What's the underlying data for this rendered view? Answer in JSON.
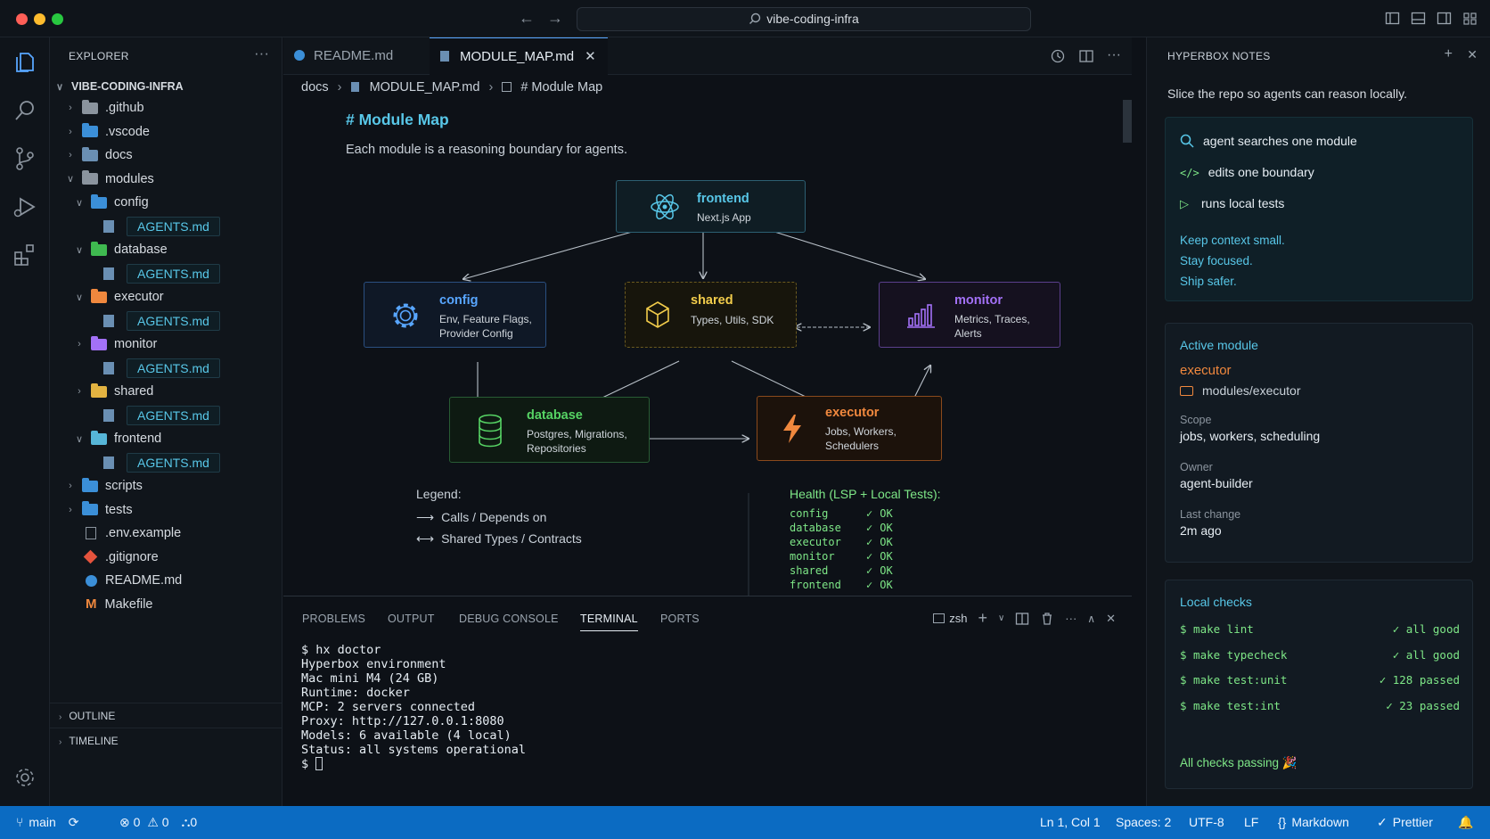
{
  "window": {
    "search": "vibe-coding-infra"
  },
  "explorer": {
    "title": "EXPLORER",
    "root": "VIBE-CODING-INFRA",
    "items": [
      {
        "label": ".github"
      },
      {
        "label": ".vscode"
      },
      {
        "label": "docs"
      },
      {
        "label": "modules"
      },
      {
        "label": "config"
      },
      {
        "label": "AGENTS.md"
      },
      {
        "label": "database"
      },
      {
        "label": "AGENTS.md"
      },
      {
        "label": "executor"
      },
      {
        "label": "AGENTS.md"
      },
      {
        "label": "monitor"
      },
      {
        "label": "AGENTS.md"
      },
      {
        "label": "shared"
      },
      {
        "label": "AGENTS.md"
      },
      {
        "label": "frontend"
      },
      {
        "label": "AGENTS.md"
      },
      {
        "label": "scripts"
      },
      {
        "label": "tests"
      },
      {
        "label": ".env.example"
      },
      {
        "label": ".gitignore"
      },
      {
        "label": "README.md"
      },
      {
        "label": "Makefile"
      }
    ],
    "outline": "OUTLINE",
    "timeline": "TIMELINE"
  },
  "tabs": [
    {
      "label": "README.md"
    },
    {
      "label": "MODULE_MAP.md"
    }
  ],
  "breadcrumb": {
    "a": "docs",
    "b": "MODULE_MAP.md",
    "c": "# Module Map"
  },
  "doc": {
    "heading": "# Module Map",
    "subtitle": "Each module is a reasoning boundary for agents.",
    "nodes": {
      "frontend": {
        "title": "frontend",
        "desc": "Next.js App"
      },
      "config": {
        "title": "config",
        "desc1": "Env, Feature Flags,",
        "desc2": "Provider Config"
      },
      "shared": {
        "title": "shared",
        "desc1": "Types, Utils, SDK"
      },
      "monitor": {
        "title": "monitor",
        "desc1": "Metrics, Traces,",
        "desc2": "Alerts"
      },
      "database": {
        "title": "database",
        "desc1": "Postgres, Migrations,",
        "desc2": "Repositories"
      },
      "executor": {
        "title": "executor",
        "desc1": "Jobs, Workers,",
        "desc2": "Schedulers"
      }
    },
    "legend": {
      "title": "Legend:",
      "calls": "Calls / Depends on",
      "shared": "Shared Types / Contracts"
    },
    "health": {
      "title": "Health (LSP + Local Tests):",
      "rows": [
        {
          "name": "config",
          "status": "OK"
        },
        {
          "name": "database",
          "status": "OK"
        },
        {
          "name": "executor",
          "status": "OK"
        },
        {
          "name": "monitor",
          "status": "OK"
        },
        {
          "name": "shared",
          "status": "OK"
        },
        {
          "name": "frontend",
          "status": "OK"
        }
      ]
    }
  },
  "panel": {
    "tabs": [
      "PROBLEMS",
      "OUTPUT",
      "DEBUG CONSOLE",
      "TERMINAL",
      "PORTS"
    ],
    "shell": "zsh",
    "terminal": [
      "$ hx doctor",
      "Hyperbox environment",
      "Mac mini M4 (24 GB)",
      "Runtime: docker",
      "MCP: 2 servers connected",
      "Proxy: http://127.0.0.1:8080",
      "Models: 6 available (4 local)",
      "Status: all systems operational"
    ],
    "prompt": "$"
  },
  "notes": {
    "title": "HYPERBOX NOTES",
    "intro": "Slice the repo so agents can reason locally.",
    "steps": [
      "agent searches one module",
      "edits one boundary",
      "runs local tests"
    ],
    "mottos": [
      "Keep context small.",
      "Stay focused.",
      "Ship safer."
    ],
    "active": {
      "heading": "Active module",
      "name": "executor",
      "path": "modules/executor",
      "scope_label": "Scope",
      "scope": "jobs, workers, scheduling",
      "owner_label": "Owner",
      "owner": "agent-builder",
      "change_label": "Last change",
      "change": "2m ago"
    },
    "checks": {
      "heading": "Local checks",
      "rows": [
        {
          "cmd": "$ make lint",
          "result": "✓ all good"
        },
        {
          "cmd": "$ make typecheck",
          "result": "✓ all good"
        },
        {
          "cmd": "$ make test:unit",
          "result": "✓ 128 passed"
        },
        {
          "cmd": "$ make test:int",
          "result": "✓ 23 passed"
        }
      ],
      "footer": "All checks passing 🎉"
    }
  },
  "status": {
    "branch": "main",
    "errors": "0",
    "warnings": "0",
    "ports": "0",
    "position": "Ln 1, Col 1",
    "spaces": "Spaces: 2",
    "encoding": "UTF-8",
    "eol": "LF",
    "language": "Markdown",
    "formatter": "Prettier"
  },
  "colors": {
    "accent": "#58c7e8",
    "status_bar": "#0b6bc2",
    "ok": "#7ee787",
    "executor": "#f0883e",
    "shared": "#f2cc4b",
    "monitor": "#a371f7",
    "database": "#56d364",
    "config": "#58a6ff"
  }
}
